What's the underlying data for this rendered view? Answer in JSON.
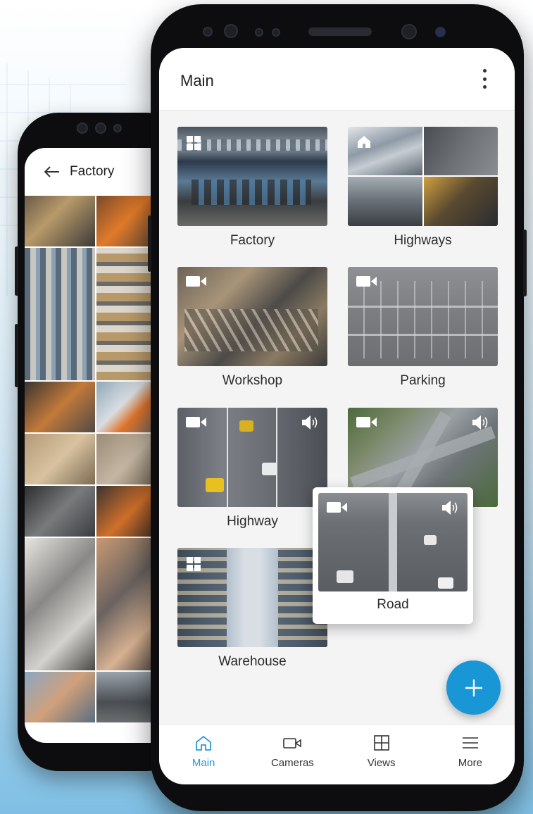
{
  "back_phone": {
    "title": "Factory",
    "back_icon": "arrow-left-icon"
  },
  "main": {
    "title": "Main",
    "menu_icon": "more-vertical-icon",
    "tiles": [
      {
        "label": "Factory",
        "type_icon": "grid-view-icon"
      },
      {
        "label": "Highways",
        "type_icon": "home-icon"
      },
      {
        "label": "Workshop",
        "type_icon": "camera-icon"
      },
      {
        "label": "Parking",
        "type_icon": "camera-icon"
      },
      {
        "label": "Highway",
        "type_icon": "camera-icon",
        "audio_icon": "speaker-icon"
      },
      {
        "label": "",
        "type_icon": "camera-icon",
        "audio_icon": "speaker-icon"
      },
      {
        "label": "Warehouse",
        "type_icon": "grid-view-icon"
      }
    ],
    "drag_popup": {
      "label": "Road",
      "type_icon": "camera-icon",
      "audio_icon": "speaker-icon"
    },
    "fab_icon": "plus-icon"
  },
  "bottom_nav": [
    {
      "label": "Main",
      "icon": "home-icon",
      "active": true
    },
    {
      "label": "Cameras",
      "icon": "camera-icon",
      "active": false
    },
    {
      "label": "Views",
      "icon": "grid-view-icon",
      "active": false
    },
    {
      "label": "More",
      "icon": "menu-icon",
      "active": false
    }
  ],
  "colors": {
    "accent": "#1996d6",
    "active_nav": "#2a9ad8",
    "phone_body": "#0d0d0f"
  }
}
